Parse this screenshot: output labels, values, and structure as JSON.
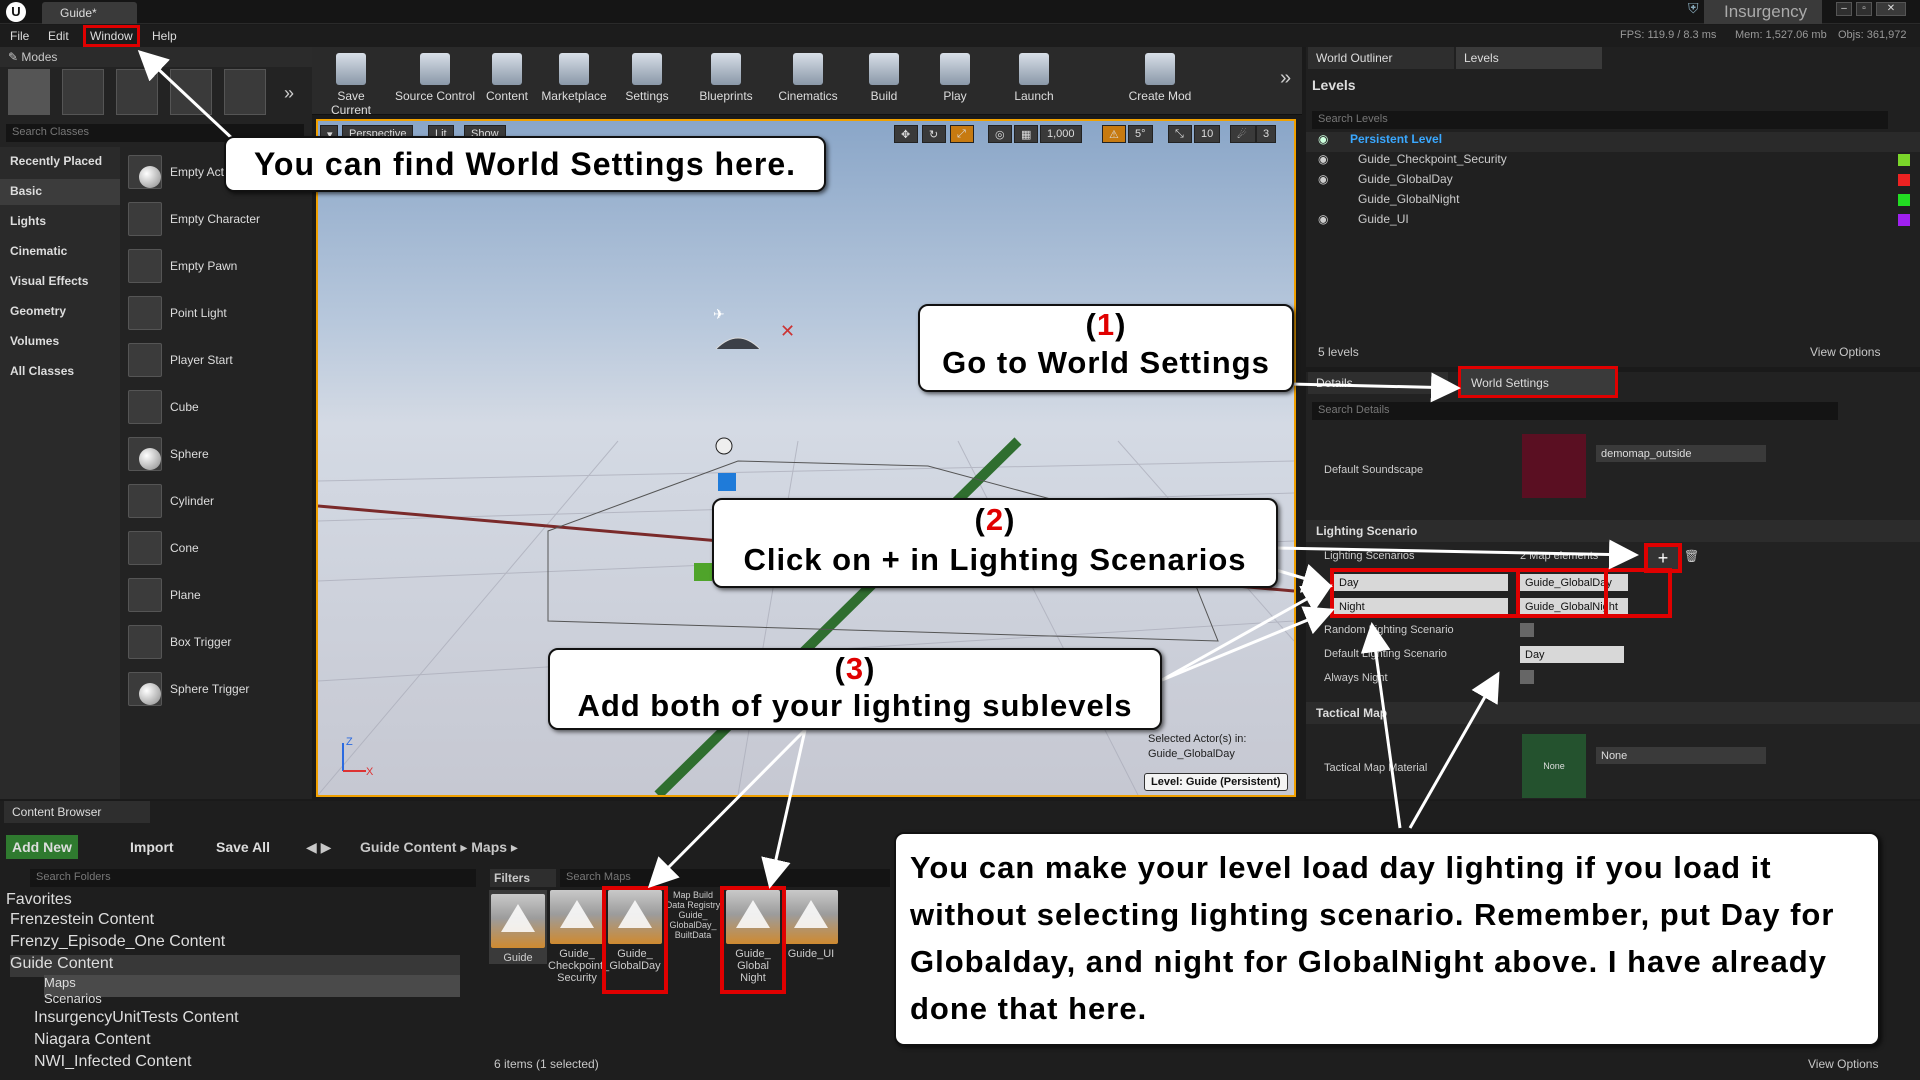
{
  "title_bar": {
    "doc_tab": "Guide*",
    "project": "Insurgency"
  },
  "menu": {
    "items": [
      "File",
      "Edit",
      "Window",
      "Help"
    ],
    "stats": {
      "fps": "FPS: 119.9 / 8.3 ms",
      "mem": "Mem: 1,527.06 mb",
      "objs": "Objs: 361,972"
    }
  },
  "modes": {
    "tab": "Modes",
    "search_placeholder": "Search Classes",
    "categories": [
      "Recently Placed",
      "Basic",
      "Lights",
      "Cinematic",
      "Visual Effects",
      "Geometry",
      "Volumes",
      "All Classes"
    ],
    "items": [
      "Empty Actor",
      "Empty Character",
      "Empty Pawn",
      "Point Light",
      "Player Start",
      "Cube",
      "Sphere",
      "Cylinder",
      "Cone",
      "Plane",
      "Box Trigger",
      "Sphere Trigger"
    ]
  },
  "toolbar": {
    "buttons": [
      "Save Current",
      "Source Control",
      "Content",
      "Marketplace",
      "Settings",
      "Blueprints",
      "Cinematics",
      "Build",
      "Play",
      "Launch",
      "Create Mod"
    ]
  },
  "viewport": {
    "buttons": [
      "Perspective",
      "Lit",
      "Show"
    ],
    "grid": "1,000",
    "rot": "5°",
    "scale": "10",
    "speed": "3",
    "selected_label": "Selected Actor(s) in:",
    "selected_level": "Guide_GlobalDay",
    "level_badge": "Level:  Guide (Persistent)"
  },
  "outliner": {
    "tabs": [
      "World Outliner",
      "Levels"
    ],
    "header": "Levels",
    "search_placeholder": "Search Levels",
    "levels": [
      {
        "name": "Persistent Level",
        "color": "#5fb85f"
      },
      {
        "name": "Guide_Checkpoint_Security",
        "color": "#7ad62a"
      },
      {
        "name": "Guide_GlobalDay",
        "color": "#e22"
      },
      {
        "name": "Guide_GlobalNight",
        "color": "#2d2"
      },
      {
        "name": "Guide_UI",
        "color": "#a020f0"
      }
    ],
    "count": "5 levels",
    "view_options": "View Options"
  },
  "details": {
    "tabs": [
      "Details",
      "World Settings"
    ],
    "search_placeholder": "Search Details",
    "soundscape_label": "Default Soundscape",
    "soundscape_value": "demomap_outside",
    "section_lighting": "Lighting Scenario",
    "scenarios_label": "Lighting Scenarios",
    "scenarios_count": "2 Map elements",
    "day_key": "Day",
    "day_val": "Guide_GlobalDay",
    "night_key": "Night",
    "night_val": "Guide_GlobalNight",
    "random_label": "Random Lighting Scenario",
    "default_label": "Default Lighting Scenario",
    "default_val": "Day",
    "always_night": "Always Night",
    "section_tactical": "Tactical Map",
    "tactical_label": "Tactical Map Material",
    "tactical_thumb": "None",
    "tactical_val": "None"
  },
  "content_browser": {
    "tab": "Content Browser",
    "add_new": "Add New",
    "import": "Import",
    "save_all": "Save All",
    "path": [
      "Guide Content",
      "Maps"
    ],
    "folder_search": "Search Folders",
    "favorites": "Favorites",
    "folders": [
      "Frenzestein Content",
      "Frenzy_Episode_One Content",
      "Guide Content",
      "Maps",
      "Scenarios",
      "InsurgencyUnitTests Content",
      "Niagara Content",
      "NWI_Infected Content"
    ],
    "filters": "Filters",
    "map_search": "Search Maps",
    "assets": [
      "Guide",
      "Guide_ Checkpoint_ Security",
      "Guide_ GlobalDay",
      "Map Build Data Registry Guide_ GlobalDay_ BuiltData",
      "Guide_ Global Night",
      "Guide_UI"
    ],
    "status": "6 items (1 selected)",
    "view_options": "View Options"
  },
  "callouts": {
    "c0": "You can find World Settings here.",
    "c1_num": "1",
    "c1": "Go to World Settings",
    "c2_num": "2",
    "c2": "Click on + in Lighting Scenarios",
    "c3_num": "3",
    "c3": "Add both of your lighting sublevels",
    "c4": "You can make your level load day lighting if you load it without selecting lighting scenario. Remember, put Day for Globalday, and night for GlobalNight above. I have already done that here."
  }
}
